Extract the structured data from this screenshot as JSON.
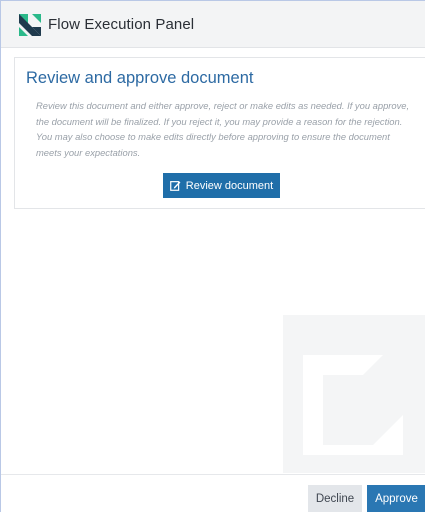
{
  "header": {
    "title": "Flow Execution Panel",
    "logo_icon": "flow-logo-icon"
  },
  "card": {
    "title": "Review and approve document",
    "description": "Review this document and either approve, reject or make edits as needed. If you approve, the document will be finalized. If you reject it, you may provide a reason for the rejection. You may also choose to make edits directly before approving to ensure the document meets your expectations.",
    "review_button": {
      "label": "Review document",
      "icon": "edit-icon"
    }
  },
  "footer": {
    "decline_label": "Decline",
    "approve_label": "Approve"
  },
  "colors": {
    "accent": "#1f6ea9",
    "title": "#2d6aa3",
    "logo_green": "#2bb98a",
    "logo_dark": "#1f3a4d"
  }
}
